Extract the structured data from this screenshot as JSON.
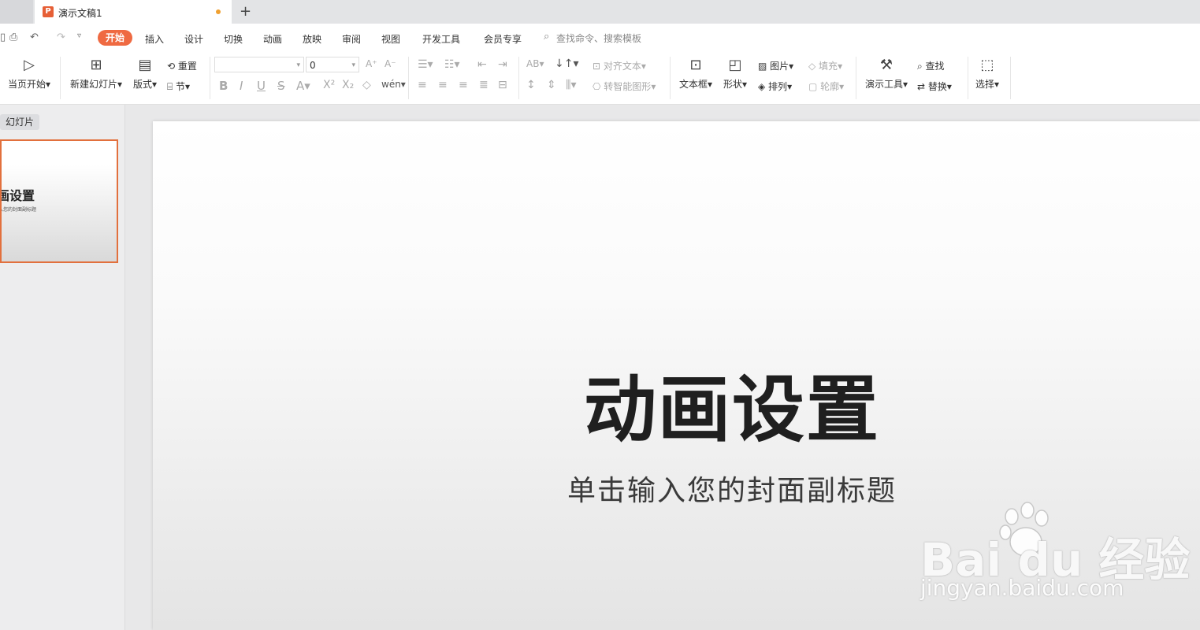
{
  "tab": {
    "doc_title": "演示文稿1",
    "doc_icon": "P",
    "new_tab": "+"
  },
  "menu": {
    "items": [
      "开始",
      "插入",
      "设计",
      "切换",
      "动画",
      "放映",
      "审阅",
      "视图",
      "开发工具",
      "会员专享"
    ],
    "search_placeholder": "查找命令、搜索模板"
  },
  "ribbon": {
    "from_current": "当页开始",
    "new_slide": "新建幻灯片",
    "layout": "版式",
    "reset": "重置",
    "section": "节",
    "font_size": "0",
    "align_text": "对齐文本",
    "smartart": "转智能图形",
    "textbox": "文本框",
    "shape": "形状",
    "picture": "图片",
    "fill": "填充",
    "arrange": "排列",
    "outline": "轮廓",
    "present_tools": "演示工具",
    "find": "查找",
    "replace": "替换",
    "select": "选择"
  },
  "left_pane": {
    "tab": "幻灯片",
    "thumb_title": "画设置",
    "thumb_sub": "入您的封面副标题"
  },
  "slide": {
    "title": "动画设置",
    "subtitle": "单击输入您的封面副标题"
  },
  "watermark": {
    "logo": "Bai  du 经验",
    "url": "jingyan.baidu.com"
  },
  "colors": {
    "accent": "#ef6a42",
    "selected_border": "#e2703d"
  }
}
